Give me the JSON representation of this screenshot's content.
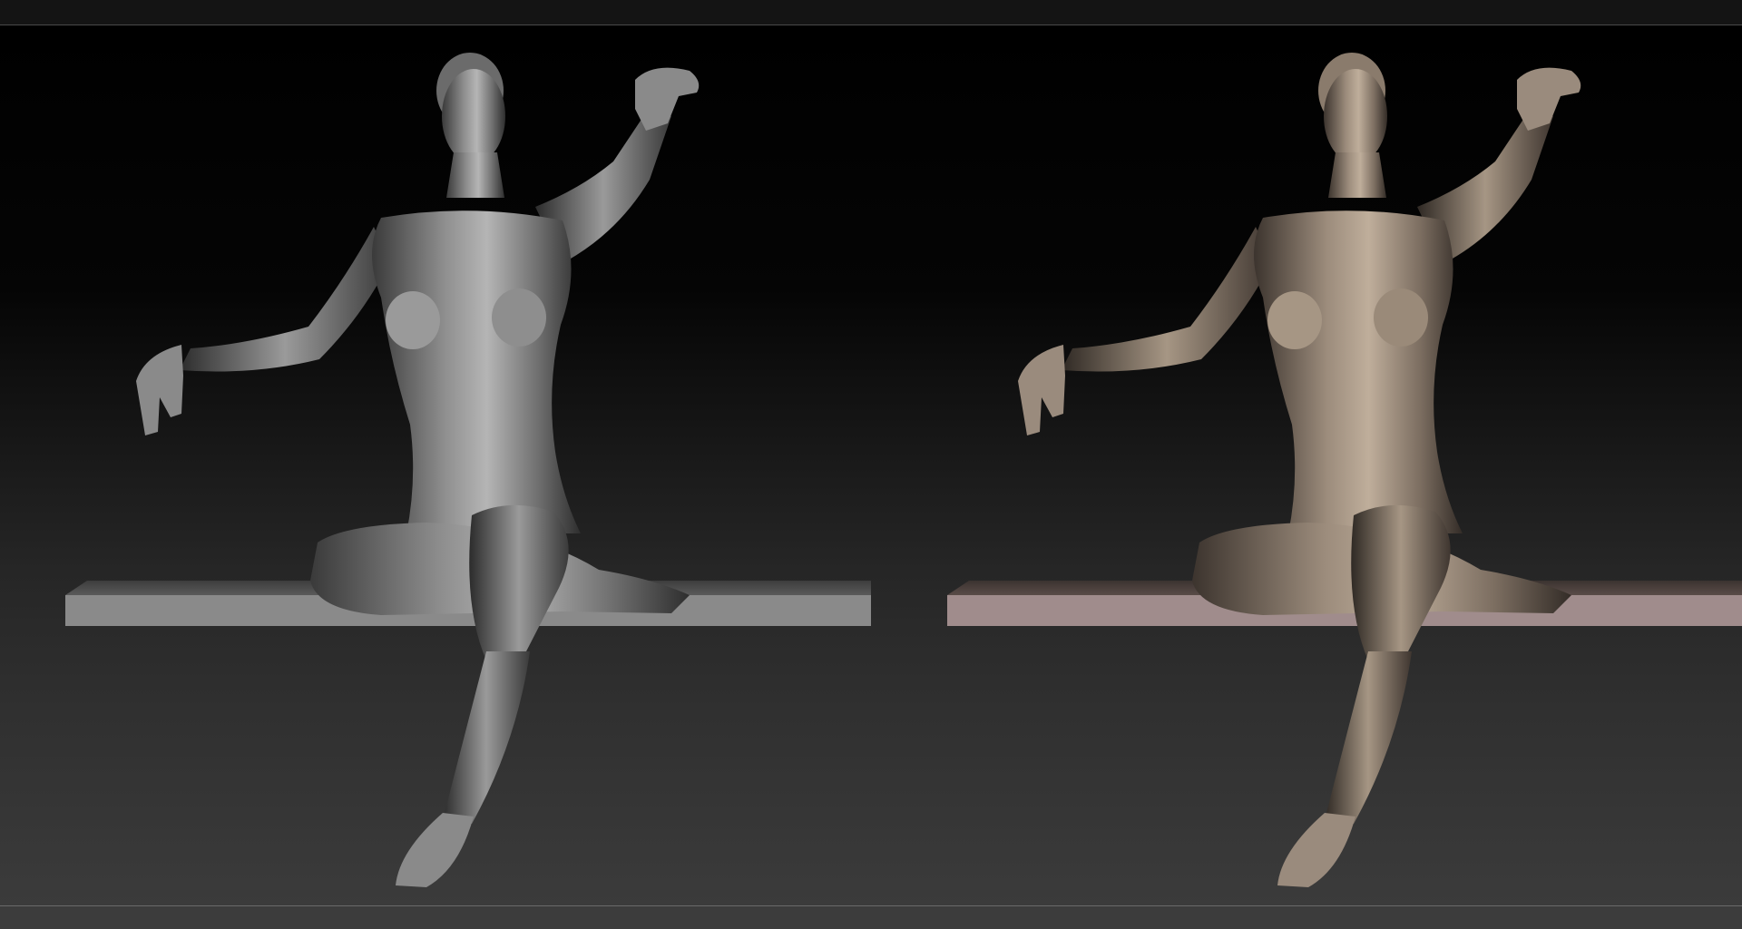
{
  "colors": {
    "background_top": "#000000",
    "background_bottom": "#3b3b3b",
    "grey_material": "#8c8c8c",
    "grey_material_highlight": "#cfcfcf",
    "skin_material": "#9a8b7d",
    "skin_material_highlight": "#c9b9a6",
    "grey_plinth": "#8a8a8a",
    "pink_plinth": "#a08c8c"
  },
  "viewports": [
    {
      "label": "",
      "material": "grey"
    },
    {
      "label": "",
      "material": "skin"
    }
  ]
}
